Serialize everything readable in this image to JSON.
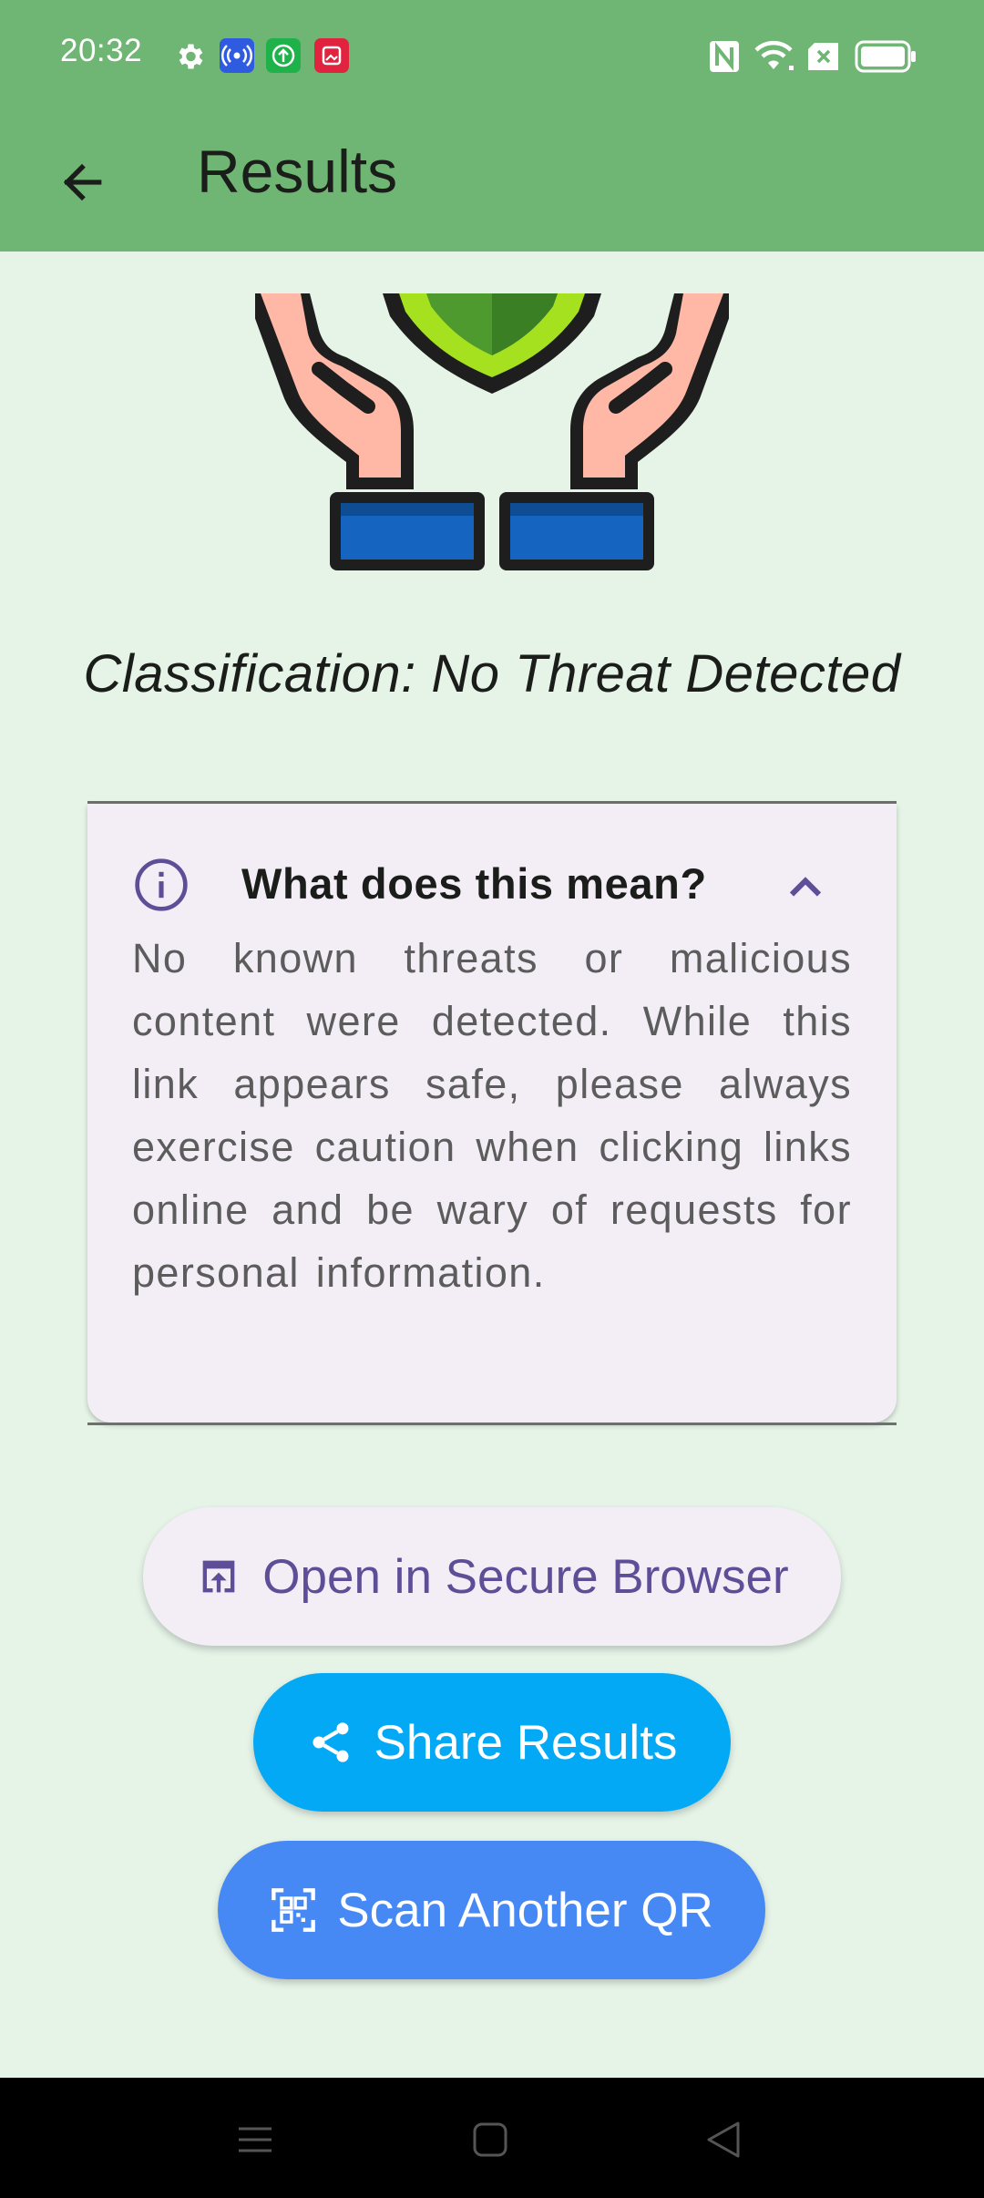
{
  "status_bar": {
    "time": "20:32",
    "icons": [
      "gear-icon",
      "radio-app-icon",
      "upload-app-icon",
      "gallery-app-icon",
      "nfc-icon",
      "wifi-icon",
      "no-sim-icon",
      "battery-icon"
    ]
  },
  "app_bar": {
    "title": "Results",
    "back_icon": "arrow-left-icon"
  },
  "result": {
    "illustration": "hands-holding-shield-icon",
    "classification": "Classification: No Threat Detected"
  },
  "info_card": {
    "title": "What does this mean?",
    "body": "No known threats or malicious content were detected. While this link appears safe, please always exercise caution when clicking links online and be wary of requests for personal information.",
    "icon": "info-icon",
    "expanded": true
  },
  "actions": {
    "open_label": "Open in Secure Browser",
    "share_label": "Share Results",
    "scan_label": "Scan Another QR"
  },
  "colors": {
    "app_bar": "#6FB573",
    "background": "#E6F4E8",
    "card": "#F3EEF6",
    "accent_purple": "#5D4E97",
    "share_button": "#03A9F4",
    "scan_button": "#4689F4"
  },
  "nav_bar": {
    "icons": [
      "menu-icon",
      "home-icon",
      "back-icon"
    ]
  }
}
